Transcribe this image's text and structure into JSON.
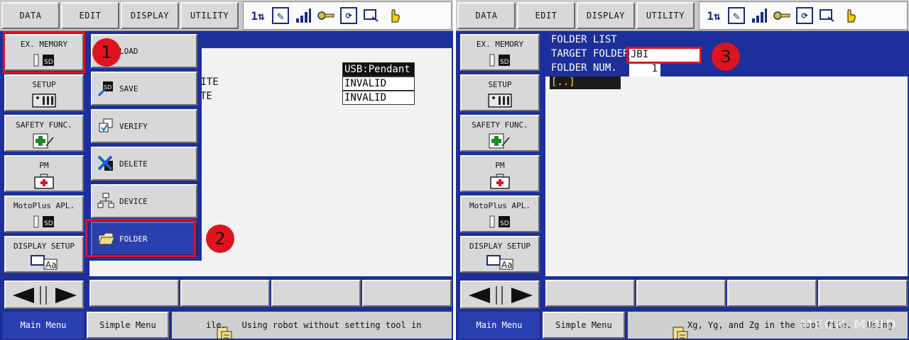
{
  "menubar": {
    "data": "DATA",
    "edit": "EDIT",
    "display": "DISPLAY",
    "utility": "UTILITY"
  },
  "sidebar": {
    "items": [
      {
        "label": "EX. MEMORY",
        "icon": "sd-card-icon"
      },
      {
        "label": "SETUP",
        "icon": "setup-panel-icon"
      },
      {
        "label": "SAFETY FUNC.",
        "icon": "safety-cross-icon"
      },
      {
        "label": "PM",
        "icon": "first-aid-kit-icon"
      },
      {
        "label": "MotoPlus APL.",
        "icon": "sd-card-icon"
      },
      {
        "label": "DISPLAY SETUP",
        "icon": "display-font-icon"
      }
    ]
  },
  "popup": {
    "items": [
      {
        "label": "LOAD",
        "icon": "load-icon"
      },
      {
        "label": "SAVE",
        "icon": "save-sd-icon"
      },
      {
        "label": "VERIFY",
        "icon": "verify-icon"
      },
      {
        "label": "DELETE",
        "icon": "delete-x-icon"
      },
      {
        "label": "DEVICE",
        "icon": "device-tree-icon"
      },
      {
        "label": "FOLDER",
        "icon": "folder-icon"
      }
    ]
  },
  "left_content": {
    "row1_value": "USB:Pendant",
    "row2_label": "RITE",
    "row2_value": "INVALID",
    "row3_label": "TE",
    "row3_value": "INVALID"
  },
  "right_content": {
    "folder_list": "FOLDER LIST",
    "target_folder_label": "TARGET FOLDER",
    "target_folder_value": "JBI",
    "folder_num_label": "FOLDER NUM.",
    "folder_num_value": "1",
    "entry": "[..]"
  },
  "bottom": {
    "main_menu": "Main Menu",
    "simple_menu": "Simple Menu",
    "left_message": "ile.   Using robot without setting tool in",
    "right_message": "Xg, Yg, and Zg in the tool file.   Using"
  },
  "badges": {
    "one": "1",
    "two": "2",
    "three": "3"
  },
  "watermark": "MECH MIND",
  "colors": {
    "navy": "#1d2f9a",
    "highlight": "#e0141e",
    "button": "#d8d8d8"
  }
}
